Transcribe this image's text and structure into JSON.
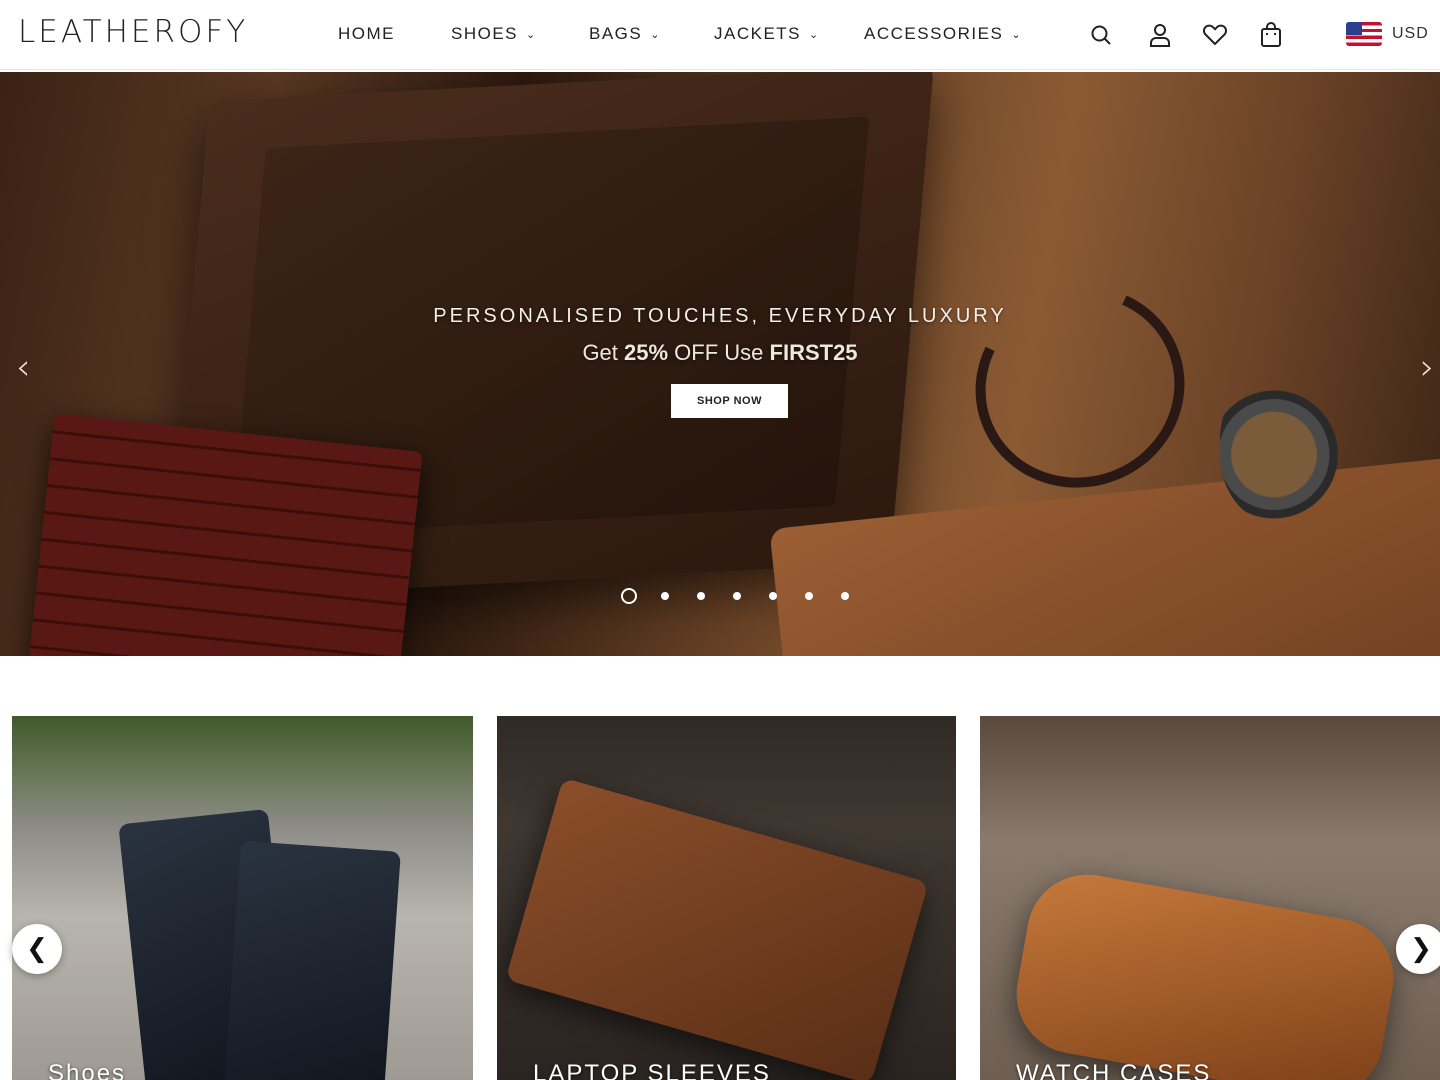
{
  "header": {
    "logo": "LEATHEROFY",
    "nav": [
      {
        "label": "HOME",
        "has_dropdown": false
      },
      {
        "label": "SHOES",
        "has_dropdown": true
      },
      {
        "label": "BAGS",
        "has_dropdown": true
      },
      {
        "label": "JACKETS",
        "has_dropdown": true
      },
      {
        "label": "ACCESSORIES",
        "has_dropdown": true
      }
    ],
    "icons": [
      "search-icon",
      "account-icon",
      "wishlist-heart-icon",
      "cart-bag-icon"
    ],
    "currency": "USD"
  },
  "hero": {
    "title": "PERSONALISED TOUCHES, EVERYDAY LUXURY",
    "subtitle_pre": "Get ",
    "subtitle_bold1": "25%",
    "subtitle_mid": " OFF  Use ",
    "subtitle_bold2": "FIRST25",
    "button": "SHOP NOW",
    "prev_arrow": "‹",
    "next_arrow": "›",
    "slide_count": 7,
    "active_slide": 1
  },
  "categories": {
    "items": [
      {
        "label": "Shoes"
      },
      {
        "label": "LAPTOP SLEEVES"
      },
      {
        "label": "WATCH CASES"
      }
    ],
    "prev": "❮",
    "next": "❯"
  },
  "colors": {
    "accent": "#222222",
    "hero_text": "#f4efe9"
  }
}
